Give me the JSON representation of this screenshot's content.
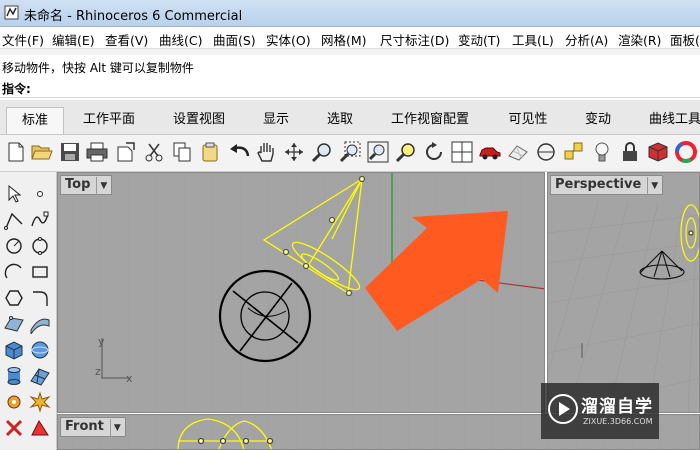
{
  "window": {
    "title": "未命名 - Rhinoceros 6 Commercial"
  },
  "menu": [
    "文件(F)",
    "编辑(E)",
    "查看(V)",
    "曲线(C)",
    "曲面(S)",
    "实体(O)",
    "网格(M)",
    "尺寸标注(D)",
    "变动(T)",
    "工具(L)",
    "分析(A)",
    "渲染(R)",
    "面板(P)"
  ],
  "command": {
    "history": "移动物件，快按 Alt 键可以复制物件",
    "prompt": "指令:"
  },
  "tabs": [
    "标准",
    "工作平面",
    "设置视图",
    "显示",
    "选取",
    "工作视窗配置",
    "可见性",
    "变动",
    "曲线工具"
  ],
  "active_tab": "标准",
  "viewports": {
    "top": "Top",
    "perspective": "Perspective",
    "front": "Front"
  },
  "axes": {
    "x": "x",
    "y": "y",
    "z": "z"
  },
  "watermark": {
    "brand": "溜溜自学",
    "site": "ZIXUE.3D66.COM"
  },
  "colors": {
    "grid_bg": "#a4a4a4",
    "annotation_arrow": "#ff5a1f",
    "selected": "#ffff00",
    "x_axis": "#b03030",
    "y_axis": "#2e9e2e"
  },
  "toolbar_icons": [
    "new-file-icon",
    "open-folder-icon",
    "save-icon",
    "print-icon",
    "import-icon",
    "cut-icon",
    "copy-icon",
    "paste-icon",
    "undo-icon",
    "pan-hand-icon",
    "rotate-view-icon",
    "zoom-icon",
    "zoom-window-icon",
    "zoom-extents-icon",
    "zoom-selected-icon",
    "rotate-icon",
    "four-viewports-icon",
    "car-icon",
    "plane-icon",
    "grid-snap-icon",
    "cplane-icon",
    "lightbulb-icon",
    "lock-icon",
    "material-icon",
    "color-wheel-icon"
  ]
}
